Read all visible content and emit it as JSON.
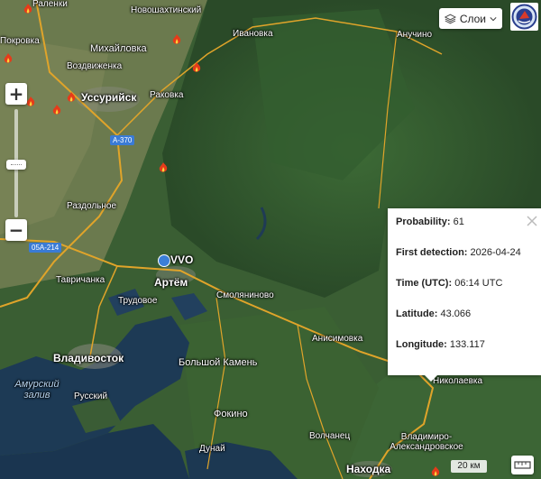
{
  "map": {
    "layers_button": {
      "label": "Слои",
      "icon": "layers-icon"
    },
    "zoom_in_label": "+",
    "zoom_out_label": "−",
    "scale_label": "20 км",
    "places": [
      "Раленки",
      "Новошахтинский",
      "Покровка",
      "Михайловка",
      "Ивановка",
      "Анучино",
      "Воздвиженка",
      "Уссурийск",
      "Раковка",
      "Раздольное",
      "Тавричанка",
      "Артём",
      "Смоляниново",
      "Трудовое",
      "Владивосток",
      "Анисимовка",
      "Большой Камень",
      "Николаевка",
      "Амурский залив",
      "Русский",
      "Фокино",
      "Волчанец",
      "Владимиро-Александровское",
      "Дунай",
      "Находка"
    ],
    "airport_code": "VVO",
    "roads": [
      "A-370",
      "05A-214"
    ],
    "fire_icon": "fire-icon"
  },
  "popup": {
    "probability_label": "Probability:",
    "probability_value": "61",
    "detection_label": "First detection:",
    "detection_value": "2026-04-24",
    "time_label": "Time (UTC):",
    "time_value": "06:14 UTC",
    "lat_label": "Latitude:",
    "lat_value": "43.066",
    "lon_label": "Longitude:",
    "lon_value": "133.117"
  },
  "colors": {
    "road": "#e0a42a",
    "road_badge": "#3a7bd5",
    "fire": "#e53b1a"
  }
}
